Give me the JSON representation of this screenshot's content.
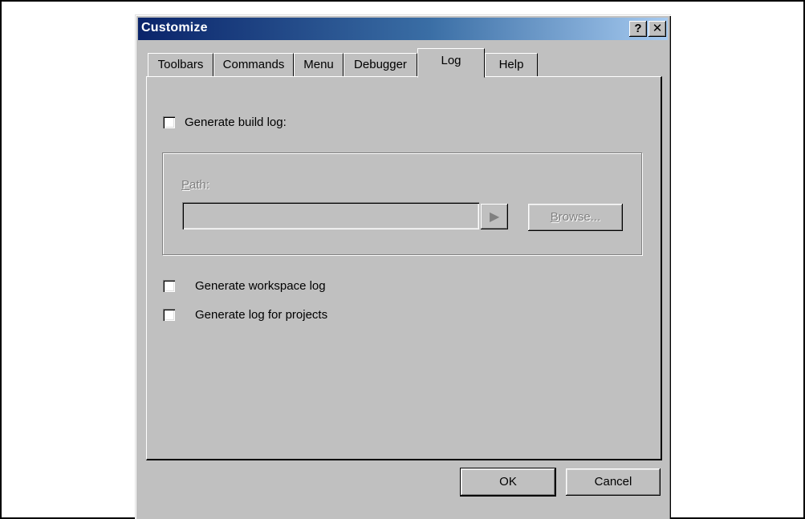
{
  "window": {
    "title": "Customize",
    "help_label": "?",
    "close_label": "✕"
  },
  "tabs": [
    {
      "label": "Toolbars"
    },
    {
      "label": "Commands"
    },
    {
      "label": "Menu"
    },
    {
      "label": "Debugger"
    },
    {
      "label": "Log",
      "active": true
    },
    {
      "label": "Help"
    }
  ],
  "log_tab": {
    "generate_build_log": {
      "label": "Generate build log:",
      "checked": false
    },
    "path": {
      "label_first": "P",
      "label_rest": "ath:",
      "value": "",
      "arrow_icon": "right-triangle-icon",
      "browse_first": "B",
      "browse_rest": "rowse...",
      "enabled": false
    },
    "generate_workspace_log": {
      "label": "Generate workspace log",
      "checked": false
    },
    "generate_log_for_projects": {
      "label": "Generate log for projects",
      "checked": false
    }
  },
  "footer": {
    "ok_label": "OK",
    "cancel_label": "Cancel"
  }
}
